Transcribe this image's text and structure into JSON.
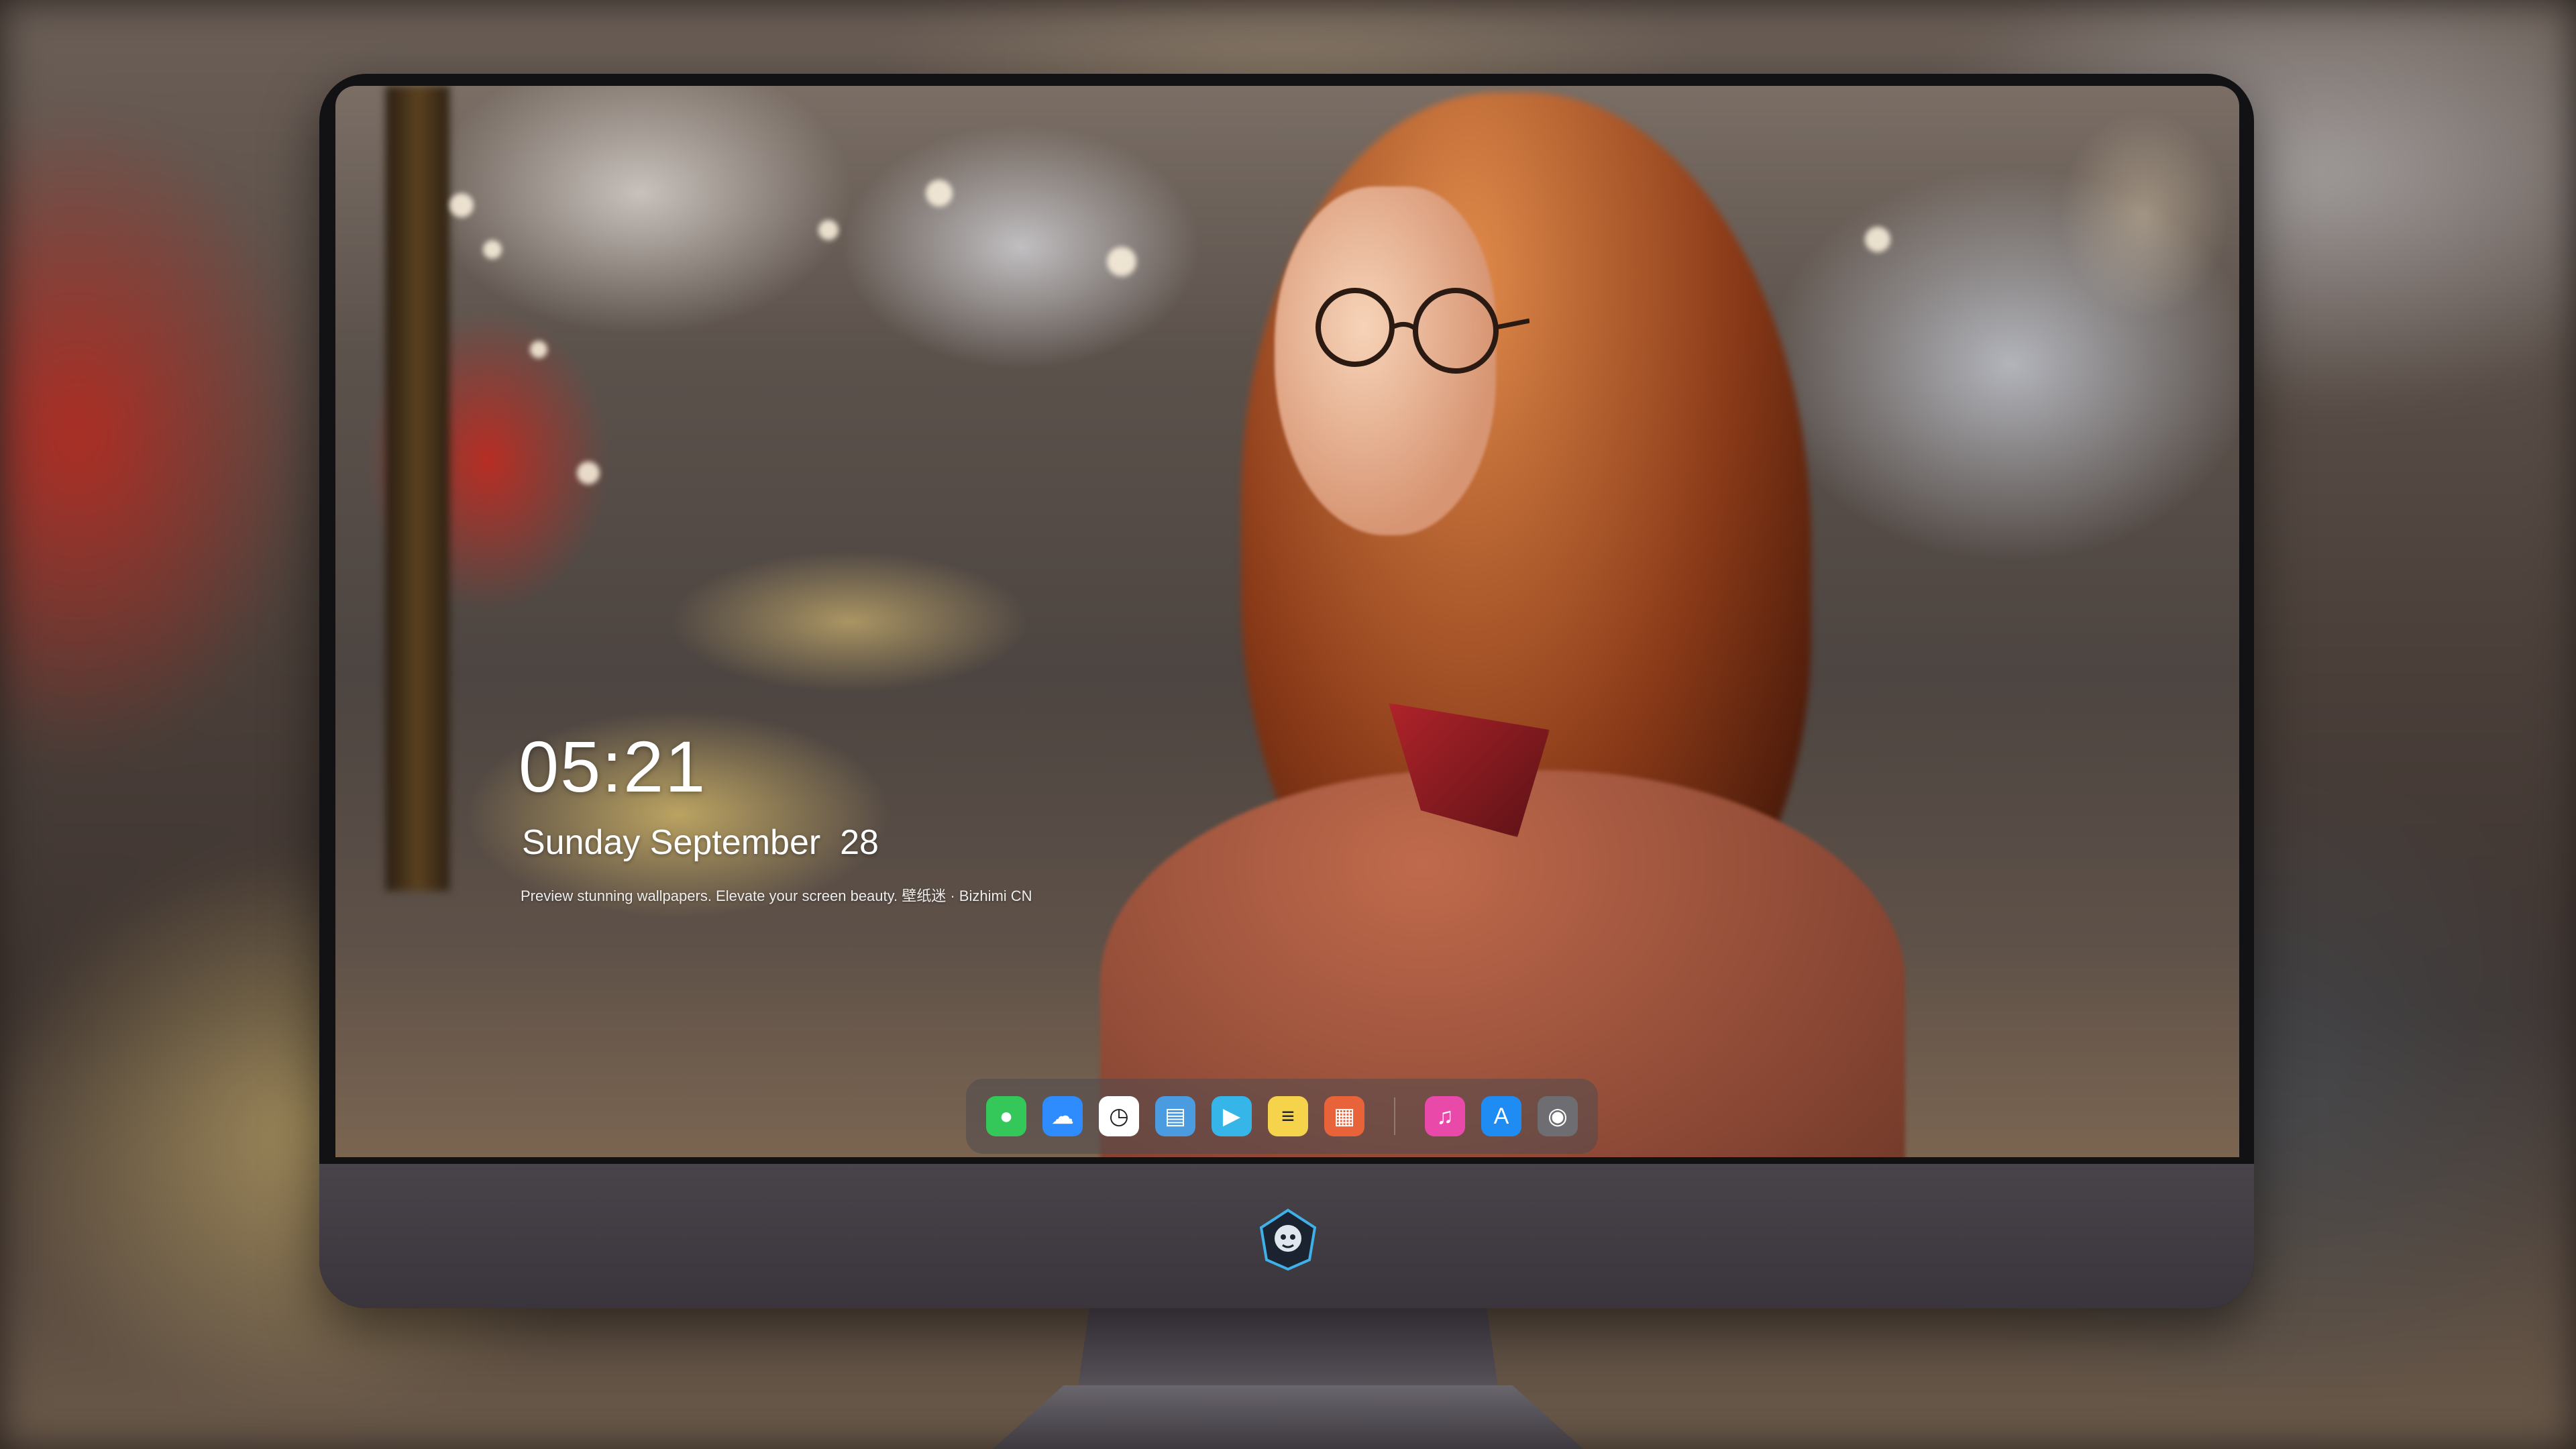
{
  "lockscreen": {
    "time": "05:21",
    "date": "Sunday September  28",
    "tagline": "Preview stunning wallpapers. Elevate your screen beauty. 壁纸迷 · Bizhimi CN"
  },
  "dock": {
    "apps": [
      {
        "name": "messages-icon",
        "glyph": "●",
        "color": "#34c759"
      },
      {
        "name": "weather-icon",
        "glyph": "☁",
        "color": "#2f8cff"
      },
      {
        "name": "clock-icon",
        "glyph": "◷",
        "color": "#ffffff"
      },
      {
        "name": "preview-icon",
        "glyph": "▤",
        "color": "#4a9be0"
      },
      {
        "name": "clips-icon",
        "glyph": "▶",
        "color": "#36b6e8"
      },
      {
        "name": "notes-icon",
        "glyph": "≡",
        "color": "#f5d34a"
      },
      {
        "name": "photo-booth-icon",
        "glyph": "▦",
        "color": "#e8623a"
      },
      {
        "name": "music-icon",
        "glyph": "♫",
        "color": "#e94aa9"
      },
      {
        "name": "app-store-icon",
        "glyph": "A",
        "color": "#1e8cf2"
      },
      {
        "name": "camera-icon",
        "glyph": "◉",
        "color": "#6e6e72"
      }
    ]
  },
  "colors": {
    "chin": "#433e45",
    "bezel": "#121214",
    "dock": "#504b4e"
  }
}
